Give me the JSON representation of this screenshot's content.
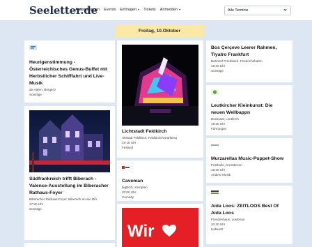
{
  "header": {
    "logo": "Seeletter.de",
    "nav": [
      {
        "label": "Ausstellungen",
        "has_dropdown": false
      },
      {
        "label": "Events",
        "has_dropdown": false
      },
      {
        "label": "Eintragen",
        "has_dropdown": true
      },
      {
        "label": "Tickets",
        "has_dropdown": false
      },
      {
        "label": "Anmelden",
        "has_dropdown": true
      }
    ],
    "filter_value": "Alle Termine"
  },
  "date_banner": "Freitag, 10.Oktober",
  "events": {
    "col1": [
      {
        "title": "Heurigenstimmung - Österreichisches Genus-Buffet mit Herbstlicher Schifffahrt und Live-Musik",
        "venue": "ab Hafen, Bregenz",
        "category": "Sonstige"
      },
      {
        "title": "Südfrankreich trifft Biberach - Valence-Ausstellung im Biberacher Rathaus-Foyer",
        "venue": "Biberacher Rathaus-Foyer, Biberach an der Riß",
        "time": "17:30 Uhr",
        "category": "Sonstige"
      }
    ],
    "col2": [
      {
        "title": "Lichtstadt Feldkirch",
        "venue": "Altstadt Feldkirch, Feldkirch/Vorarlberg",
        "time": "19:15 Uhr",
        "category": "Festival"
      },
      {
        "title": "Caveman",
        "venue": "bigBOX, Kempten",
        "time": "20:00 Uhr",
        "category": "Comedy"
      },
      {
        "poster_text": "Wir"
      }
    ],
    "col3": [
      {
        "title": "Bos Çerçeve     Leerer Rahmen, Tiyatro Frankfurt",
        "venue": "Bahnhof Fischbach, Friedrichshafen",
        "time": "19:30 Uhr",
        "category": "Sonstige"
      },
      {
        "title": "Leutkircher Kleinkunst: Die neuen Wellbappn",
        "venue": "Bocksaal, Leutkirch",
        "time": "19:30 Uhr",
        "category": "Führungen"
      },
      {
        "title": "Murzarellas Music-Puppet-Show",
        "venue": "Festhalle, Kressbronn",
        "time": "19:30 Uhr",
        "category": "Andere Musik"
      },
      {
        "title": "Aida Loos: ZEITLOOS     Best Of Aida Loos",
        "venue": "Freudenhaus, Lustenau",
        "time": "20:30 Uhr",
        "category": "Kabarett"
      }
    ]
  },
  "colors": {
    "page_bg": "#dde7f3",
    "banner_bg": "#fbe8a6",
    "logo_color": "#1f2f4e",
    "poster_red": "#e41f26"
  }
}
